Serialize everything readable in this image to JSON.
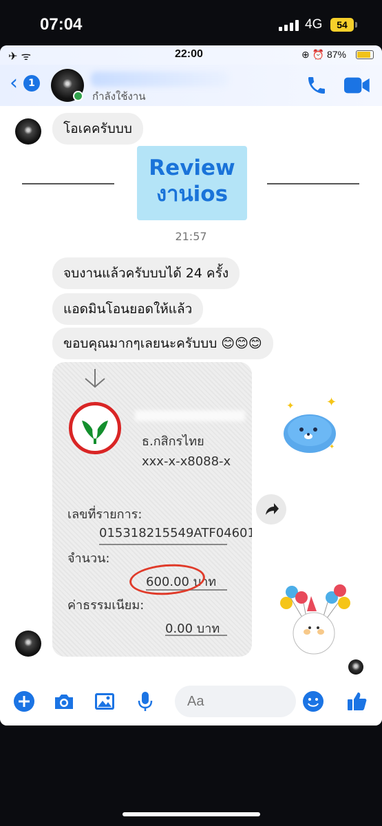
{
  "outer_status": {
    "time": "07:04",
    "network": "4G",
    "battery": "54"
  },
  "inner_status": {
    "left_icons": "✈ ᯤ",
    "time": "22:00",
    "battery_percent": "87%"
  },
  "header": {
    "back_badge": "1",
    "status": "กำลังใช้งาน"
  },
  "messages": {
    "m1": "โอเคครับบบ",
    "review_line1": "Review",
    "review_line2": "งานios",
    "timestamp": "21:57",
    "m2": "จบงานแล้วครับบบได้ 24 ครั้ง",
    "m3": "แอดมินโอนยอดให้แล้ว",
    "m4": "ขอบคุณมากๆเลยนะครับบบ 😊😊😊"
  },
  "slip": {
    "bank": "ธ.กสิกรไทย",
    "account": "xxx-x-x8088-x",
    "ref_label": "เลขที่รายการ:",
    "ref_value": "015318215549ATF04601",
    "amount_label": "จำนวน:",
    "amount_value": "600.00 บาท",
    "fee_label": "ค่าธรรมเนียม:",
    "fee_value": "0.00 บาท"
  },
  "composer": {
    "placeholder": "Aa"
  },
  "colors": {
    "messenger_blue": "#1b74e4",
    "bubble_gray": "#efefef",
    "kbank_green": "#138f2d",
    "kbank_red": "#d92525"
  },
  "icons": [
    "add-icon",
    "camera-icon",
    "gallery-icon",
    "mic-icon",
    "emoji-icon",
    "like-icon",
    "call-icon",
    "video-icon",
    "share-icon"
  ]
}
